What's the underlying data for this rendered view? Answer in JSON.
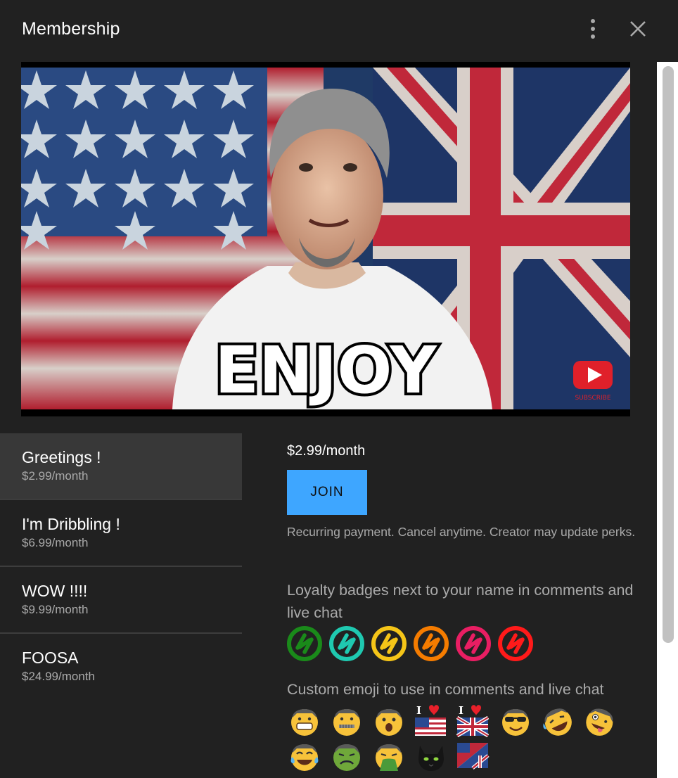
{
  "header": {
    "title": "Membership",
    "more_icon": "more-vert-icon",
    "close_icon": "close-icon"
  },
  "banner": {
    "overlay_text": "ENJOY",
    "subscribe_text": "SUBSCRIBE"
  },
  "tiers": [
    {
      "name": "Greetings !",
      "price": "$2.99/month",
      "selected": true
    },
    {
      "name": "I'm Dribbling !",
      "price": "$6.99/month",
      "selected": false
    },
    {
      "name": "WOW !!!!",
      "price": "$9.99/month",
      "selected": false
    },
    {
      "name": "FOOSA",
      "price": "$24.99/month",
      "selected": false
    }
  ],
  "detail": {
    "price": "$2.99/month",
    "join_label": "JOIN",
    "recurring_note": "Recurring payment. Cancel anytime. Creator may update perks.",
    "badges_title": "Loyalty badges next to your name in comments and live chat",
    "badge_colors": [
      "#1a8a1a",
      "#1fc9b0",
      "#f5c518",
      "#f57c00",
      "#e91e63",
      "#ff1a1a"
    ],
    "emoji_title": "Custom emoji to use in comments and live chat",
    "emojis": [
      "grinning-face-emoji",
      "zipper-mouth-face-emoji",
      "surprised-face-emoji",
      "i-love-usa-flag-emoji",
      "i-love-uk-flag-emoji",
      "sunglasses-face-emoji",
      "rofl-face-emoji",
      "zany-face-emoji",
      "tears-of-joy-face-emoji",
      "nauseated-face-emoji",
      "vomiting-face-emoji",
      "black-cat-emoji",
      "usa-uk-flag-emoji"
    ]
  },
  "colors": {
    "background": "#212121",
    "accent": "#3ea6ff",
    "secondary_text": "#aaaaaa",
    "selected_tier": "#383838"
  }
}
